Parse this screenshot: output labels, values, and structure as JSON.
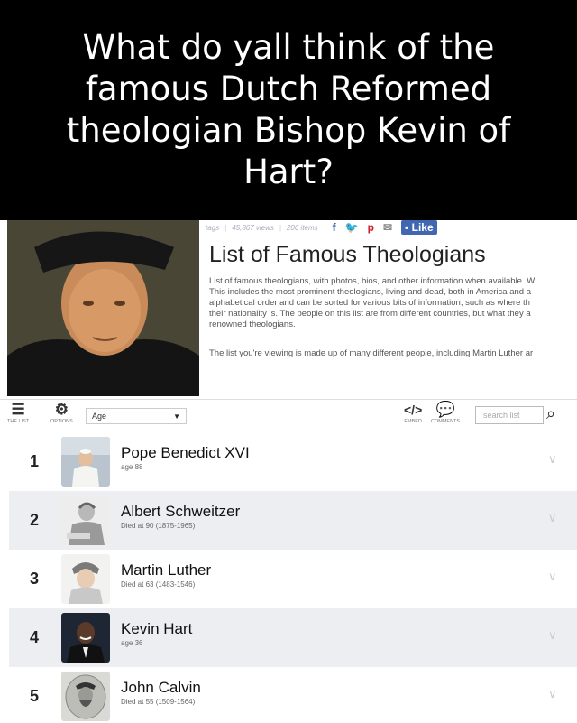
{
  "meme": {
    "caption": "What do yall think of the famous Dutch Reformed theologian Bishop Kevin of Hart?"
  },
  "topbar": {
    "tags": "tags",
    "views": "45,867 views",
    "items": "206 items",
    "like_label": "Like"
  },
  "header": {
    "title": "List of Famous Theologians",
    "description_lines": [
      "List of famous theologians, with photos, bios, and other information when available. W",
      "This includes the most prominent theologians, living and dead, both in America and a",
      "alphabetical order and can be sorted for various bits of information, such as where th",
      "their nationality is. The people on this list are from different countries, but what they a",
      "renowned theologians."
    ],
    "description_2": "The list you're viewing is made up of many different people, including Martin Luther ar"
  },
  "toolbar": {
    "the_list_label": "THE LIST",
    "options_label": "OPTIONS",
    "sort_value": "Age",
    "embed_label": "EMBED",
    "comments_label": "COMMENTS",
    "search_placeholder": "search list"
  },
  "list": [
    {
      "rank": "1",
      "name": "Pope Benedict XVI",
      "detail": "age 88"
    },
    {
      "rank": "2",
      "name": "Albert Schweitzer",
      "detail": "Died at 90 (1875-1965)"
    },
    {
      "rank": "3",
      "name": "Martin Luther",
      "detail": "Died at 63 (1483-1546)"
    },
    {
      "rank": "4",
      "name": "Kevin Hart",
      "detail": "age 36"
    },
    {
      "rank": "5",
      "name": "John Calvin",
      "detail": "Died at 55 (1509-1564)"
    }
  ],
  "colors": {
    "caption_bg": "#000000",
    "alt_row": "#eceef2",
    "like_button": "#4267b2"
  }
}
